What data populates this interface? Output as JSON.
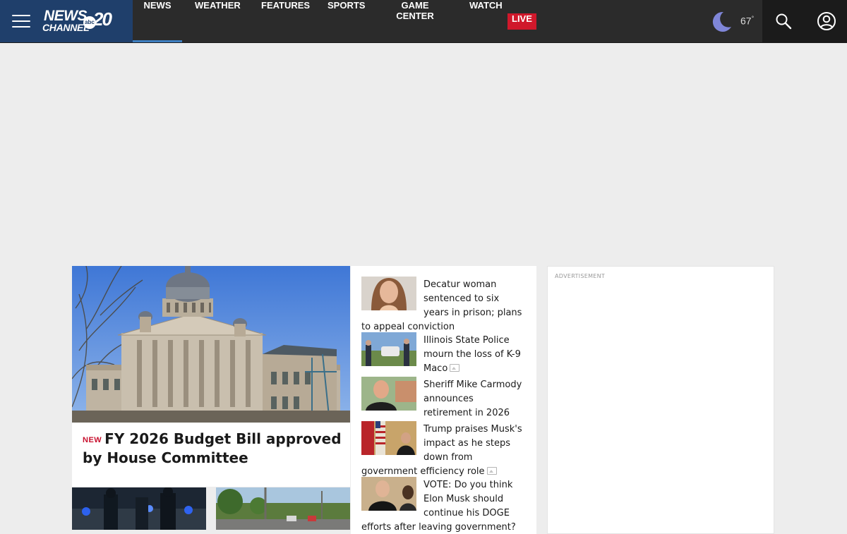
{
  "header": {
    "logo": {
      "line1": "NEWS",
      "line2": "CHANNEL",
      "network": "abc",
      "channel_number": "20"
    },
    "nav": [
      {
        "label": "NEWS",
        "active": true
      },
      {
        "label": "WEATHER"
      },
      {
        "label": "FEATURES"
      },
      {
        "label": "SPORTS"
      },
      {
        "label": "GAME CENTER"
      },
      {
        "label": "WATCH"
      }
    ],
    "live_badge": "LIVE",
    "weather": {
      "temperature": "67",
      "degree_symbol": "°",
      "icon": "moon-icon"
    },
    "icons": {
      "menu": "hamburger-menu-icon",
      "search": "search-icon",
      "account": "account-icon"
    }
  },
  "hero": {
    "tag": "NEW",
    "title": "FY 2026 Budget Bill approved by House Committee",
    "image": "illinois-capitol-photo"
  },
  "headlines": [
    {
      "title": "Decatur woman sentenced to six years in prison; plans to appeal conviction",
      "gallery": false
    },
    {
      "title": "Illinois State Police mourn the loss of K-9 Maco",
      "gallery": true
    },
    {
      "title": "Sheriff Mike Carmody announces retirement in 2026",
      "gallery": false
    },
    {
      "title": "Trump praises Musk's impact as he steps down from government efficiency role",
      "gallery": true
    },
    {
      "title": "VOTE: Do you think Elon Musk should continue his DOGE efforts after leaving government?",
      "gallery": false
    }
  ],
  "advertisement": {
    "label": "ADVERTISEMENT"
  },
  "colors": {
    "header_bg": "#2b2b2b",
    "brand_bg": "#1f3f6b",
    "live_red": "#d0182b",
    "new_tag_red": "#c8102e",
    "active_underline": "#3e7fc1",
    "page_bg": "#ededed"
  }
}
